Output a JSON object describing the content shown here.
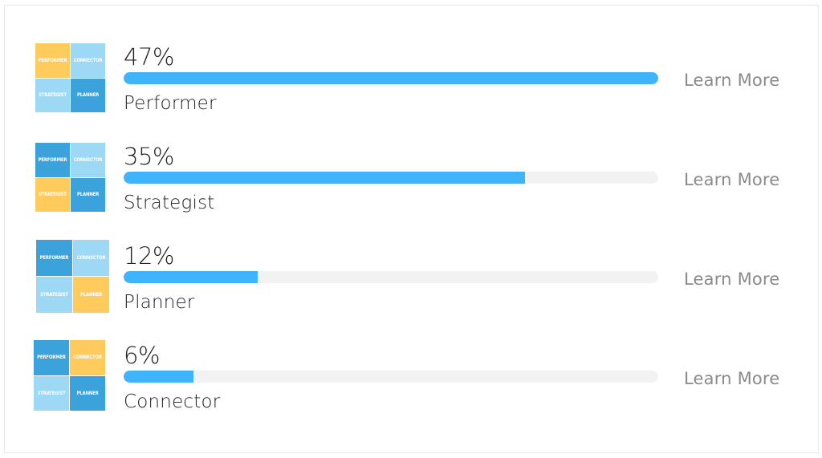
{
  "colors": {
    "yellow": "#FFCB5C",
    "light_blue": "#9DD8F5",
    "dark_blue": "#3BA2DC",
    "bar_fill": "#3FB4FB",
    "bar_track": "#F2F2F2",
    "text": "#222222",
    "link": "#8A8A8A"
  },
  "grid_labels": [
    "Performer",
    "Connector",
    "Strategist",
    "Planner"
  ],
  "rows": [
    {
      "percent_label": "47%",
      "percent": 47,
      "bar_fill_fraction": 1.0,
      "name": "Performer",
      "link_label": "Learn More",
      "highlight": "Performer",
      "cell_colors": [
        "yellow",
        "light_blue",
        "light_blue",
        "dark_blue"
      ]
    },
    {
      "percent_label": "35%",
      "percent": 35,
      "bar_fill_fraction": 0.75,
      "name": "Strategist",
      "link_label": "Learn More",
      "highlight": "Strategist",
      "cell_colors": [
        "dark_blue",
        "light_blue",
        "yellow",
        "dark_blue"
      ]
    },
    {
      "percent_label": "12%",
      "percent": 12,
      "bar_fill_fraction": 0.25,
      "name": "Planner",
      "link_label": "Learn More",
      "highlight": "Planner",
      "cell_colors": [
        "dark_blue",
        "light_blue",
        "light_blue",
        "yellow"
      ]
    },
    {
      "percent_label": "6%",
      "percent": 6,
      "bar_fill_fraction": 0.13,
      "name": "Connector",
      "link_label": "Learn More",
      "highlight": "Connector",
      "cell_colors": [
        "dark_blue",
        "yellow",
        "light_blue",
        "dark_blue"
      ]
    }
  ]
}
